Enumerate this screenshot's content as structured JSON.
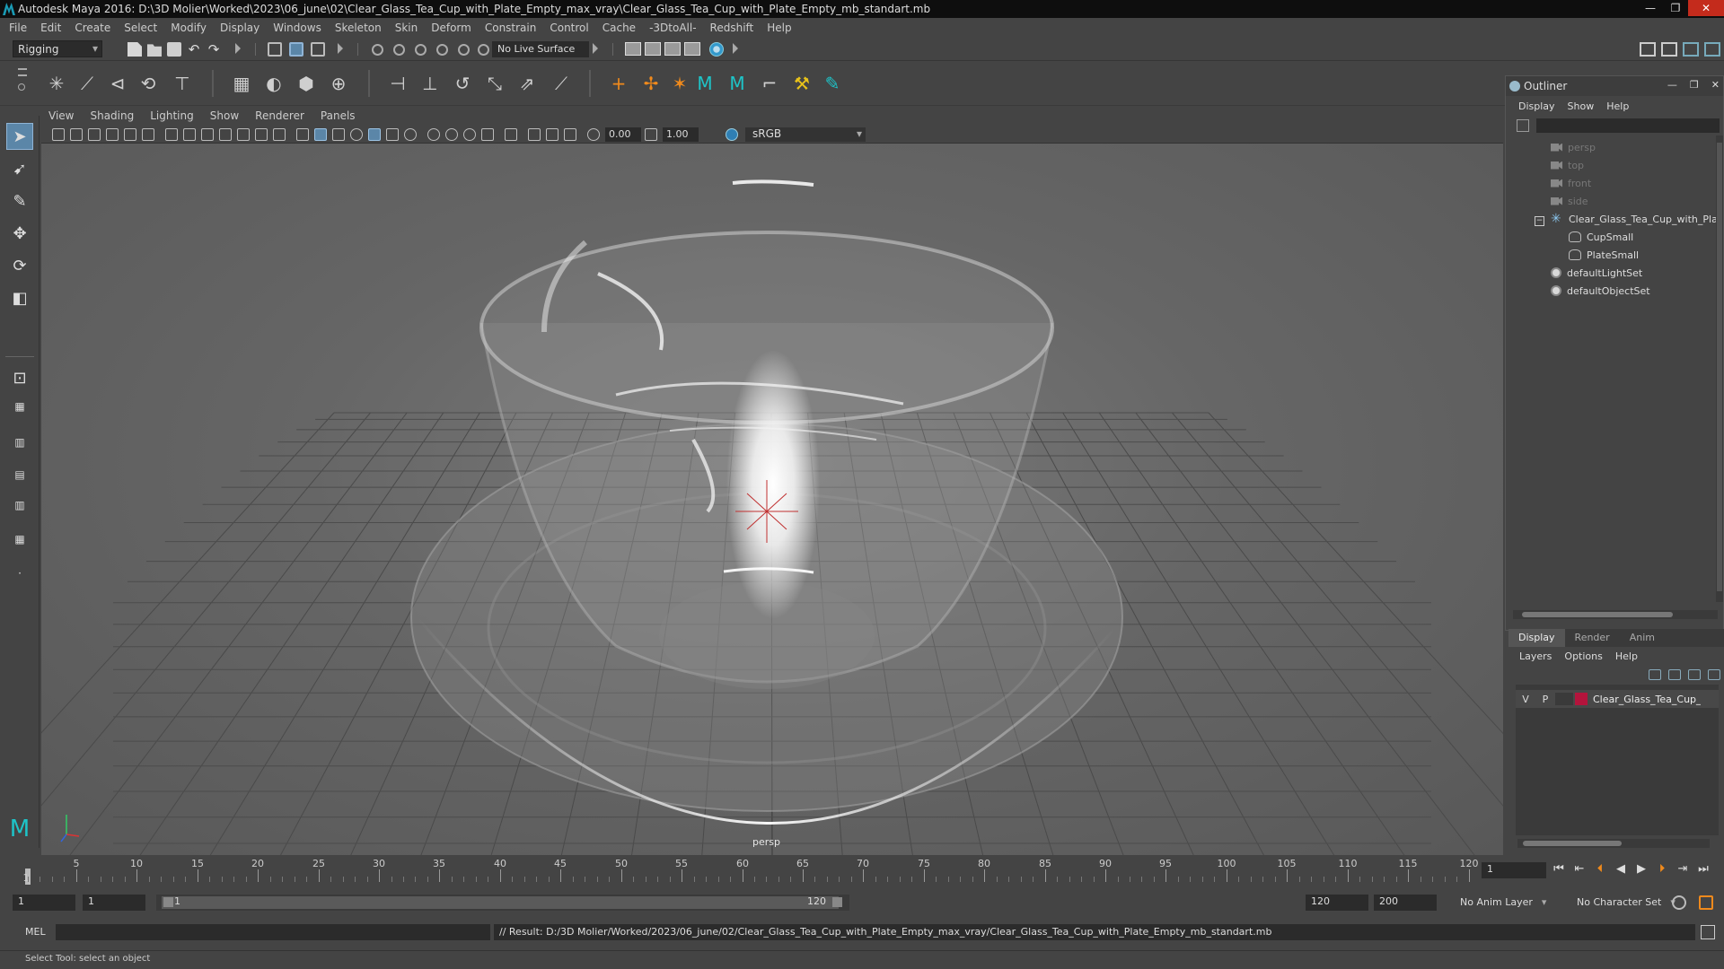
{
  "window": {
    "title": "Autodesk Maya 2016: D:\\3D Molier\\Worked\\2023\\06_june\\02\\Clear_Glass_Tea_Cup_with_Plate_Empty_max_vray\\Clear_Glass_Tea_Cup_with_Plate_Empty_mb_standart.mb",
    "controls": {
      "minimize": "—",
      "maximize": "❐",
      "close": "✕"
    }
  },
  "menubar": [
    "File",
    "Edit",
    "Create",
    "Select",
    "Modify",
    "Display",
    "Windows",
    "Skeleton",
    "Skin",
    "Deform",
    "Constrain",
    "Control",
    "Cache",
    "-3DtoAll-",
    "Redshift",
    "Help"
  ],
  "statusline": {
    "mode": "Rigging",
    "live_surface": "No Live Surface"
  },
  "viewport": {
    "menu": [
      "View",
      "Shading",
      "Lighting",
      "Show",
      "Renderer",
      "Panels"
    ],
    "exposure": "0.00",
    "gamma_value": "1.00",
    "color_space": "sRGB gamma",
    "camera_label": "persp"
  },
  "outliner": {
    "title": "Outliner",
    "menu": [
      "Display",
      "Show",
      "Help"
    ],
    "items": [
      {
        "label": "persp",
        "icon": "camera-icon",
        "dim": true
      },
      {
        "label": "top",
        "icon": "camera-icon",
        "dim": true
      },
      {
        "label": "front",
        "icon": "camera-icon",
        "dim": true
      },
      {
        "label": "side",
        "icon": "camera-icon",
        "dim": true
      },
      {
        "label": "Clear_Glass_Tea_Cup_with_Plat",
        "icon": "group-icon",
        "dim": false
      },
      {
        "label": "CupSmall",
        "icon": "mesh-icon",
        "dim": false
      },
      {
        "label": "PlateSmall",
        "icon": "mesh-icon",
        "dim": false
      },
      {
        "label": "defaultLightSet",
        "icon": "set-icon",
        "dim": false
      },
      {
        "label": "defaultObjectSet",
        "icon": "set-icon",
        "dim": false
      }
    ]
  },
  "layers": {
    "tabs": [
      "Display",
      "Render",
      "Anim"
    ],
    "menu": [
      "Layers",
      "Options",
      "Help"
    ],
    "layer": {
      "visible": "V",
      "playback": "P",
      "name": "Clear_Glass_Tea_Cup_v",
      "color": "#b4143c"
    }
  },
  "timeline": {
    "ticks": [
      "5",
      "10",
      "15",
      "20",
      "25",
      "30",
      "35",
      "40",
      "45",
      "50",
      "55",
      "60",
      "65",
      "70",
      "75",
      "80",
      "85",
      "90",
      "95",
      "100",
      "105",
      "110",
      "115",
      "120"
    ],
    "current_frame_marker": "1",
    "current_frame": "1"
  },
  "range": {
    "start": "1",
    "playback_start": "1",
    "slider_start": "1",
    "slider_end": "120",
    "playback_end": "120",
    "end": "200",
    "anim_layer": "No Anim Layer",
    "character_set": "No Character Set"
  },
  "command": {
    "label": "MEL",
    "result": "// Result: D:/3D Molier/Worked/2023/06_june/02/Clear_Glass_Tea_Cup_with_Plate_Empty_max_vray/Clear_Glass_Tea_Cup_with_Plate_Empty_mb_standart.mb"
  },
  "helpline": "Select Tool: select an object"
}
